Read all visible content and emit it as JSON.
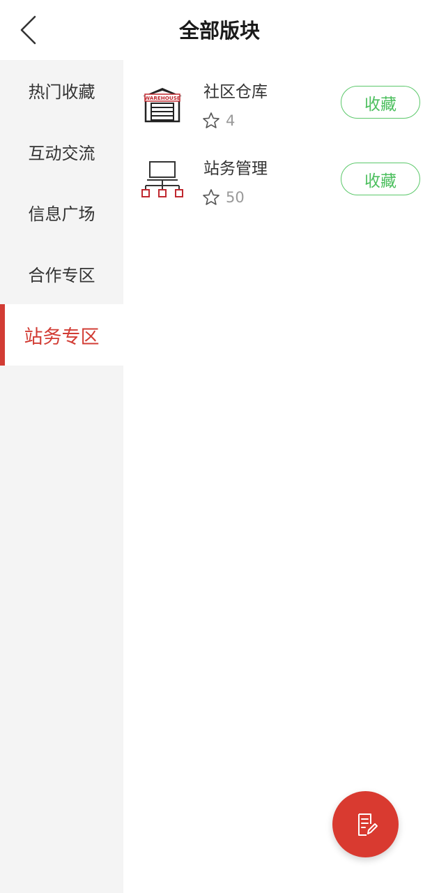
{
  "header": {
    "title": "全部版块",
    "back_icon": "chevron-left-icon"
  },
  "sidebar": {
    "items": [
      {
        "label": "热门收藏",
        "active": false
      },
      {
        "label": "互动交流",
        "active": false
      },
      {
        "label": "信息广场",
        "active": false
      },
      {
        "label": "合作专区",
        "active": false
      },
      {
        "label": "站务专区",
        "active": true
      }
    ]
  },
  "boards": [
    {
      "name": "社区仓库",
      "icon": "warehouse-icon",
      "icon_text": "WAREHOUSE",
      "count": "4",
      "action_label": "收藏"
    },
    {
      "name": "站务管理",
      "icon": "network-icon",
      "count": "50",
      "action_label": "收藏"
    }
  ],
  "fab": {
    "icon": "edit-note-icon"
  },
  "colors": {
    "accent_red": "#d23c34",
    "fab_red": "#d93a30",
    "favorite_green": "#4cbf5e",
    "sidebar_bg": "#f4f4f4",
    "muted_text": "#999999"
  }
}
